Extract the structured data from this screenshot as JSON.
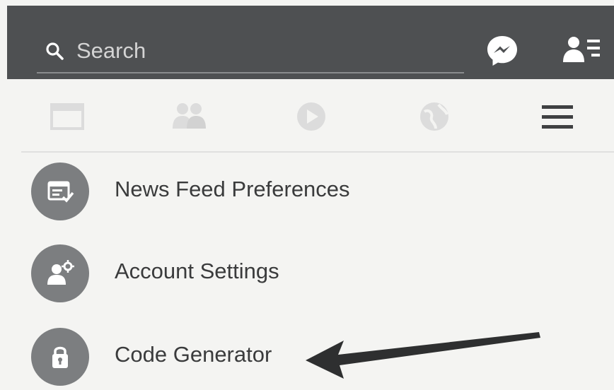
{
  "header": {
    "search": {
      "placeholder": "Search"
    },
    "icons": [
      "search-icon",
      "messenger-icon",
      "friend-requests-icon"
    ]
  },
  "tabs": [
    {
      "icon": "news-feed-icon"
    },
    {
      "icon": "friends-icon"
    },
    {
      "icon": "video-icon"
    },
    {
      "icon": "notifications-globe-icon"
    },
    {
      "icon": "menu-icon"
    }
  ],
  "menu": {
    "items": [
      {
        "label": "News Feed Preferences",
        "icon": "news-feed-preferences-icon"
      },
      {
        "label": "Account Settings",
        "icon": "account-settings-icon"
      },
      {
        "label": "Code Generator",
        "icon": "lock-icon"
      }
    ]
  },
  "colors": {
    "header_bg": "#4e5052",
    "page_bg": "#f4f4f2",
    "icon_circle": "#7c7e80",
    "faded_tab_icon": "#dcdcdc",
    "label_text": "#3a3b3c"
  }
}
